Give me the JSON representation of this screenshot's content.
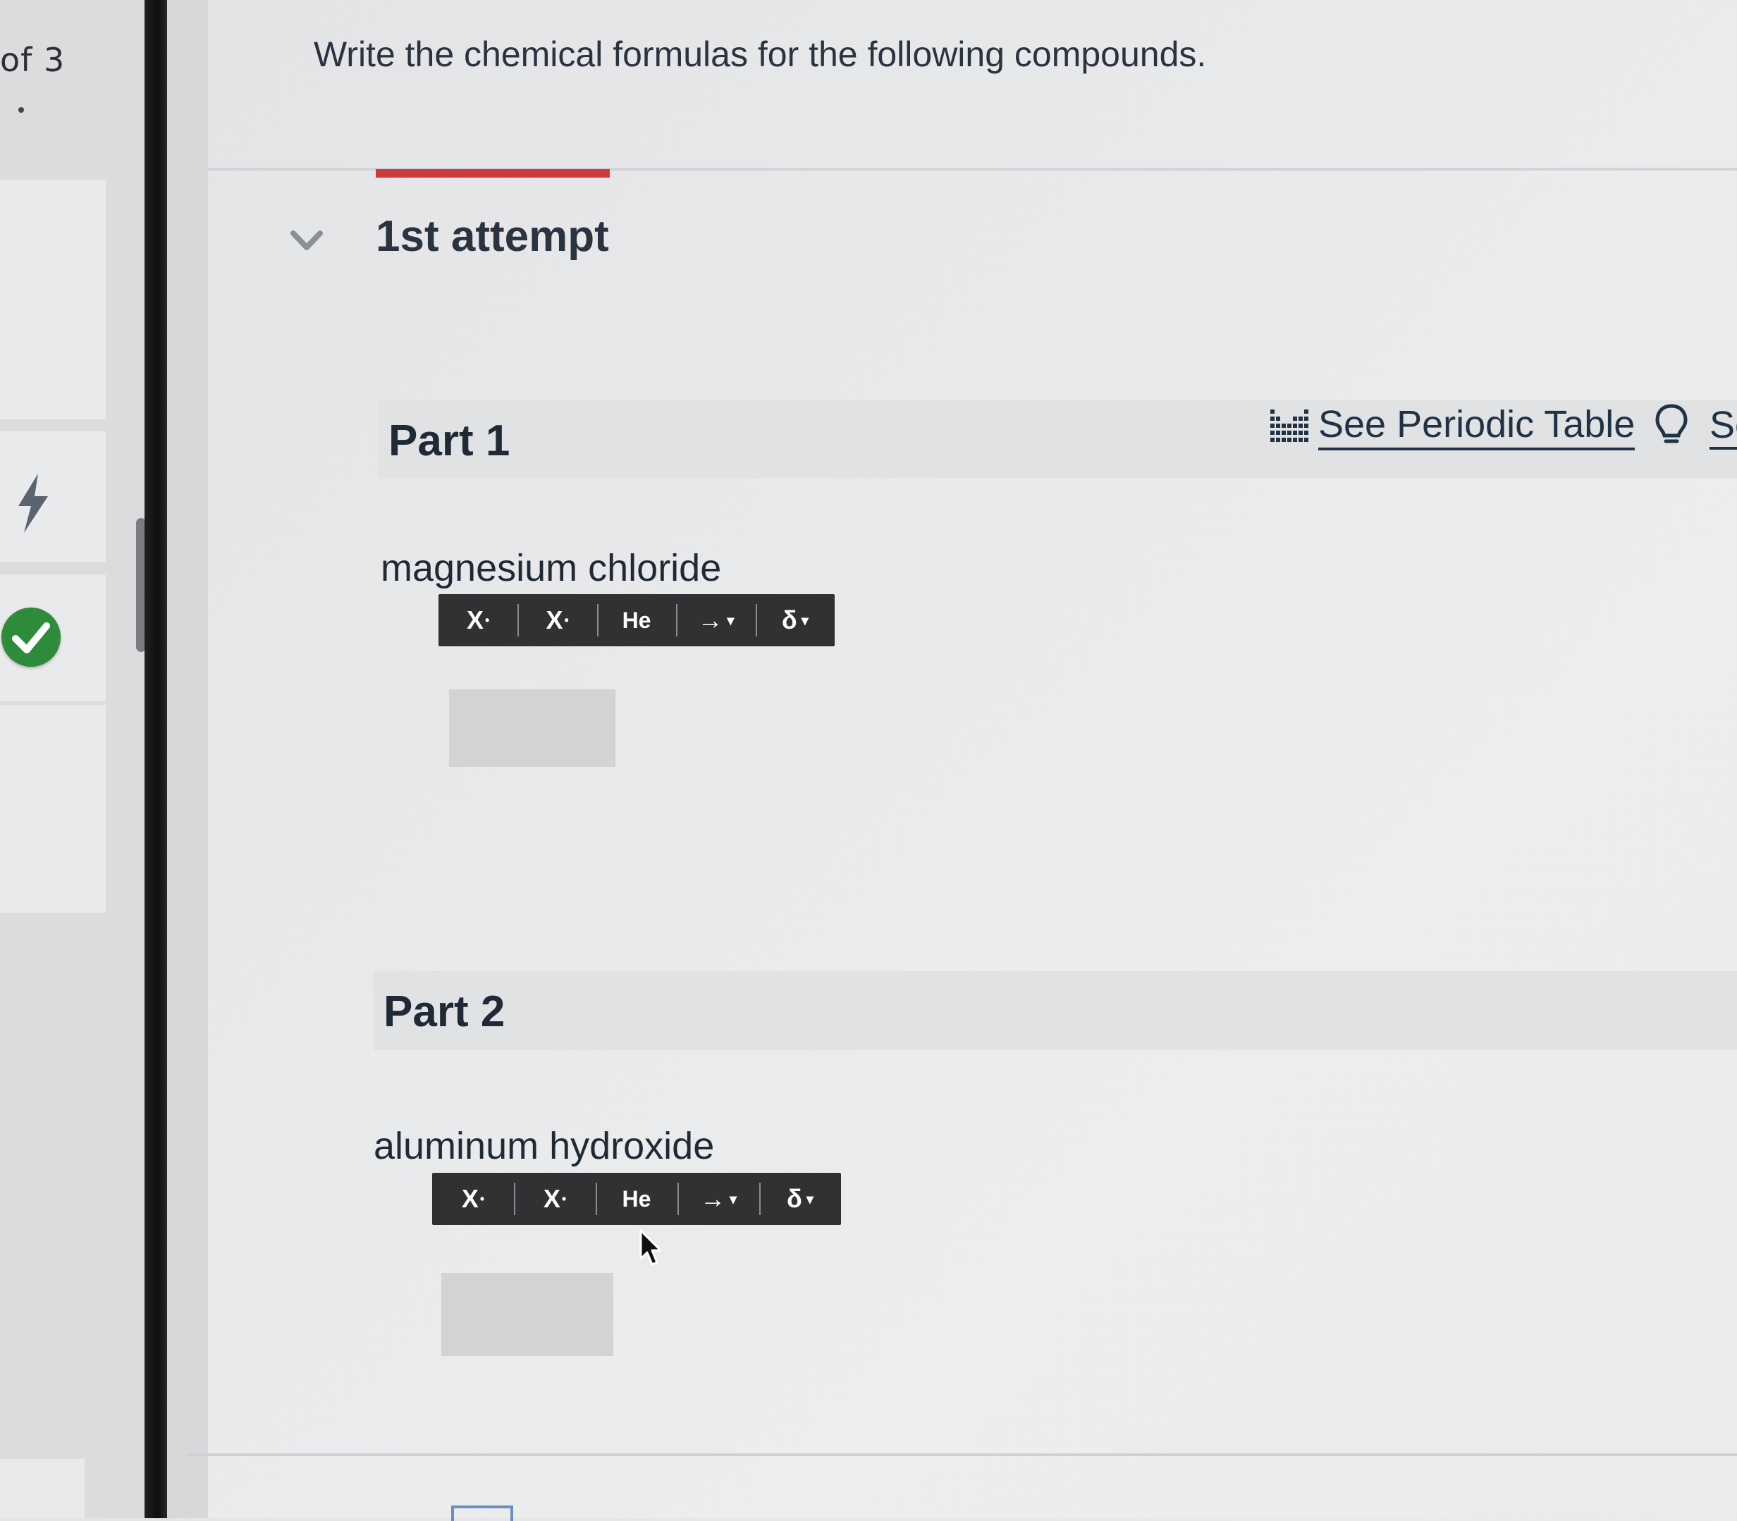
{
  "sidebar": {
    "counter": "of 3"
  },
  "main": {
    "prompt": "Write the chemical formulas for the following compounds.",
    "attempt_title": "1st attempt",
    "links": {
      "periodic_table": "See Periodic Table",
      "hint_partial": "Se"
    },
    "parts": [
      {
        "title": "Part 1",
        "compound": "magnesium chloride"
      },
      {
        "title": "Part 2",
        "compound": "aluminum hydroxide"
      }
    ]
  },
  "toolbar": {
    "superscript": "X",
    "subscript": "X",
    "element": "He",
    "arrow": "→",
    "delta": "δ",
    "caret": "▾"
  },
  "colors": {
    "attempt_accent": "#cc3b3b",
    "toolbar_bg": "#2f3133",
    "check_green": "#2e8b3a"
  },
  "icons": [
    "bolt-icon",
    "check-icon",
    "chevron-down-icon",
    "periodic-table-icon",
    "lightbulb-icon",
    "mouse-cursor-icon"
  ]
}
